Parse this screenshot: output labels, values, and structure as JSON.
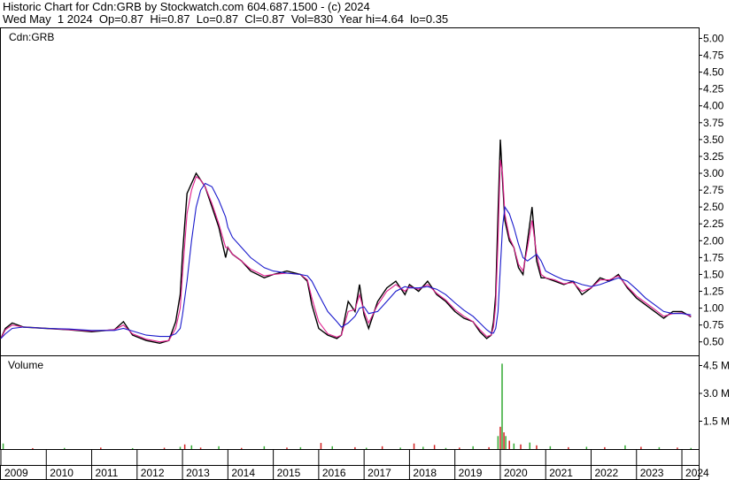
{
  "header": {
    "line1": "Historic Chart for Cdn:GRB by Stockwatch.com 604.687.1500 - (c) 2024",
    "line2": "Wed May  1 2024  Op=0.87  Hi=0.87  Lo=0.87  Cl=0.87  Vol=830  Year hi=4.64  lo=0.35"
  },
  "chart_data": [
    {
      "type": "line",
      "panel": "price",
      "symbol_label": "Cdn:GRB",
      "ylim": [
        0.3,
        5.15
      ],
      "yticks": [
        "5.00",
        "4.75",
        "4.50",
        "4.25",
        "4.00",
        "3.75",
        "3.50",
        "3.25",
        "3.00",
        "2.75",
        "2.50",
        "2.25",
        "2.00",
        "1.75",
        "1.50",
        "1.25",
        "1.00",
        "0.75",
        "0.50"
      ],
      "x_labels": [
        "2009",
        "2010",
        "2011",
        "2012",
        "2013",
        "2014",
        "2015",
        "2016",
        "2017",
        "2018",
        "2019",
        "2020",
        "2021",
        "2022",
        "2023",
        "2024"
      ],
      "x": [
        2009.0,
        2009.1,
        2009.25,
        2009.5,
        2010.0,
        2010.5,
        2011.0,
        2011.5,
        2011.7,
        2011.9,
        2012.2,
        2012.5,
        2012.7,
        2012.85,
        2012.95,
        2013.0,
        2013.1,
        2013.2,
        2013.3,
        2013.4,
        2013.5,
        2013.65,
        2013.8,
        2013.95,
        2014.0,
        2014.1,
        2014.3,
        2014.5,
        2014.8,
        2015.0,
        2015.3,
        2015.6,
        2015.75,
        2015.85,
        2016.0,
        2016.2,
        2016.4,
        2016.5,
        2016.65,
        2016.8,
        2016.9,
        2017.0,
        2017.1,
        2017.3,
        2017.5,
        2017.7,
        2017.9,
        2018.0,
        2018.2,
        2018.4,
        2018.6,
        2018.8,
        2019.0,
        2019.2,
        2019.4,
        2019.55,
        2019.7,
        2019.8,
        2019.85,
        2019.9,
        2019.95,
        2020.0,
        2020.05,
        2020.1,
        2020.2,
        2020.3,
        2020.4,
        2020.5,
        2020.6,
        2020.7,
        2020.8,
        2020.9,
        2021.0,
        2021.2,
        2021.4,
        2021.6,
        2021.8,
        2022.0,
        2022.2,
        2022.4,
        2022.6,
        2022.8,
        2023.0,
        2023.2,
        2023.4,
        2023.6,
        2023.8,
        2024.0,
        2024.2
      ],
      "series": [
        {
          "color": "#000000",
          "values": [
            0.55,
            0.7,
            0.78,
            0.72,
            0.7,
            0.68,
            0.65,
            0.68,
            0.8,
            0.6,
            0.52,
            0.48,
            0.52,
            0.8,
            1.2,
            1.8,
            2.7,
            2.85,
            3.0,
            2.9,
            2.8,
            2.5,
            2.2,
            1.75,
            1.9,
            1.8,
            1.7,
            1.55,
            1.45,
            1.5,
            1.55,
            1.5,
            1.4,
            1.05,
            0.7,
            0.6,
            0.55,
            0.6,
            1.1,
            0.95,
            1.35,
            0.9,
            0.7,
            1.1,
            1.3,
            1.4,
            1.2,
            1.35,
            1.25,
            1.4,
            1.2,
            1.1,
            0.95,
            0.85,
            0.8,
            0.65,
            0.55,
            0.6,
            0.8,
            1.2,
            2.4,
            3.5,
            2.9,
            2.3,
            2.0,
            1.9,
            1.6,
            1.5,
            2.0,
            2.5,
            1.7,
            1.45,
            1.45,
            1.4,
            1.35,
            1.4,
            1.2,
            1.3,
            1.45,
            1.4,
            1.5,
            1.3,
            1.15,
            1.05,
            0.95,
            0.85,
            0.95,
            0.95,
            0.87
          ]
        },
        {
          "color": "#e0208e",
          "values": [
            0.55,
            0.68,
            0.75,
            0.72,
            0.7,
            0.68,
            0.66,
            0.68,
            0.75,
            0.62,
            0.54,
            0.5,
            0.52,
            0.7,
            1.0,
            1.5,
            2.4,
            2.75,
            2.95,
            2.9,
            2.8,
            2.55,
            2.25,
            1.9,
            1.9,
            1.8,
            1.7,
            1.58,
            1.48,
            1.5,
            1.52,
            1.5,
            1.42,
            1.15,
            0.8,
            0.62,
            0.57,
            0.6,
            0.95,
            0.98,
            1.2,
            0.95,
            0.78,
            1.05,
            1.25,
            1.35,
            1.25,
            1.32,
            1.28,
            1.35,
            1.22,
            1.12,
            0.98,
            0.88,
            0.8,
            0.68,
            0.58,
            0.6,
            0.72,
            1.05,
            2.0,
            3.2,
            3.0,
            2.4,
            2.05,
            1.9,
            1.65,
            1.55,
            1.9,
            2.3,
            1.8,
            1.5,
            1.45,
            1.42,
            1.36,
            1.38,
            1.25,
            1.3,
            1.42,
            1.42,
            1.48,
            1.32,
            1.18,
            1.08,
            0.98,
            0.88,
            0.92,
            0.93,
            0.88
          ]
        },
        {
          "color": "#1a1acc",
          "values": [
            0.55,
            0.62,
            0.7,
            0.72,
            0.7,
            0.69,
            0.67,
            0.67,
            0.7,
            0.66,
            0.6,
            0.58,
            0.58,
            0.62,
            0.7,
            0.9,
            1.4,
            2.0,
            2.5,
            2.75,
            2.85,
            2.8,
            2.6,
            2.35,
            2.2,
            2.05,
            1.9,
            1.75,
            1.6,
            1.55,
            1.52,
            1.5,
            1.48,
            1.4,
            1.2,
            0.95,
            0.8,
            0.72,
            0.78,
            0.88,
            1.0,
            1.02,
            0.92,
            0.95,
            1.1,
            1.25,
            1.32,
            1.3,
            1.3,
            1.32,
            1.28,
            1.2,
            1.08,
            0.97,
            0.88,
            0.78,
            0.68,
            0.63,
            0.63,
            0.7,
            0.95,
            1.6,
            2.2,
            2.5,
            2.4,
            2.2,
            1.95,
            1.75,
            1.7,
            1.75,
            1.8,
            1.7,
            1.55,
            1.48,
            1.42,
            1.4,
            1.35,
            1.32,
            1.35,
            1.4,
            1.45,
            1.4,
            1.28,
            1.15,
            1.05,
            0.95,
            0.92,
            0.92,
            0.9
          ]
        }
      ]
    },
    {
      "type": "bar",
      "panel": "volume",
      "title": "Volume",
      "ylim": [
        0,
        5000000
      ],
      "yticks": [
        "4.5 M",
        "3.0 M",
        "1.5 M"
      ],
      "x": [
        2009.05,
        2009.7,
        2010.4,
        2011.2,
        2011.9,
        2012.6,
        2012.95,
        2013.05,
        2013.2,
        2013.4,
        2013.8,
        2014.3,
        2014.8,
        2015.3,
        2015.6,
        2016.05,
        2016.3,
        2016.8,
        2017.05,
        2017.4,
        2017.8,
        2018.1,
        2018.3,
        2018.55,
        2018.8,
        2019.1,
        2019.4,
        2019.75,
        2019.95,
        2020.0,
        2020.04,
        2020.08,
        2020.12,
        2020.2,
        2020.3,
        2020.45,
        2020.65,
        2020.8,
        2021.1,
        2021.5,
        2021.9,
        2022.3,
        2022.75,
        2023.1,
        2023.5,
        2023.9,
        2024.2
      ],
      "series": [
        {
          "name": "",
          "values": [
            300000,
            50000,
            60000,
            80000,
            50000,
            70000,
            120000,
            250000,
            200000,
            80000,
            150000,
            60000,
            150000,
            80000,
            100000,
            330000,
            150000,
            100000,
            70000,
            150000,
            80000,
            300000,
            120000,
            220000,
            60000,
            80000,
            150000,
            100000,
            700000,
            1200000,
            4600000,
            900000,
            700000,
            450000,
            300000,
            250000,
            350000,
            200000,
            150000,
            100000,
            120000,
            100000,
            200000,
            120000,
            100000,
            80000,
            60000
          ]
        }
      ]
    }
  ]
}
